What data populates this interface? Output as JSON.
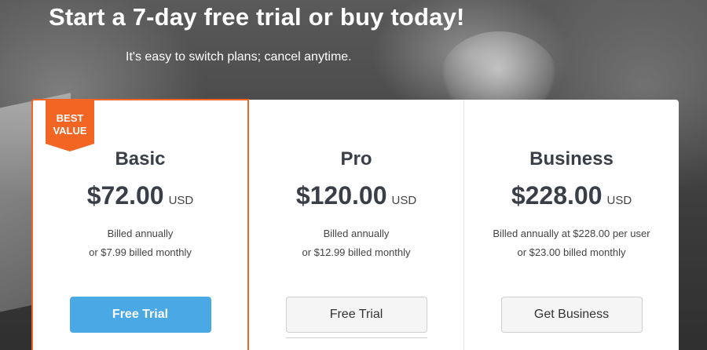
{
  "hero": {
    "headline": "Start a 7-day free trial or buy today!",
    "subline": "It's easy to switch plans; cancel anytime."
  },
  "plans": [
    {
      "ribbon": "BEST\nVALUE",
      "name": "Basic",
      "price": "$72.00",
      "currency": "USD",
      "billing_line1": "Billed annually",
      "billing_line2": "or $7.99 billed monthly",
      "button_label": "Free Trial"
    },
    {
      "name": "Pro",
      "price": "$120.00",
      "currency": "USD",
      "billing_line1": "Billed annually",
      "billing_line2": "or $12.99 billed monthly",
      "button_label": "Free Trial"
    },
    {
      "name": "Business",
      "price": "$228.00",
      "currency": "USD",
      "billing_line1": "Billed annually at $228.00 per user",
      "billing_line2": "or $23.00 billed monthly",
      "button_label": "Get Business"
    }
  ],
  "colors": {
    "accent_orange": "#f26522",
    "primary_blue": "#4aa8e4",
    "text_dark": "#3a3f47"
  }
}
